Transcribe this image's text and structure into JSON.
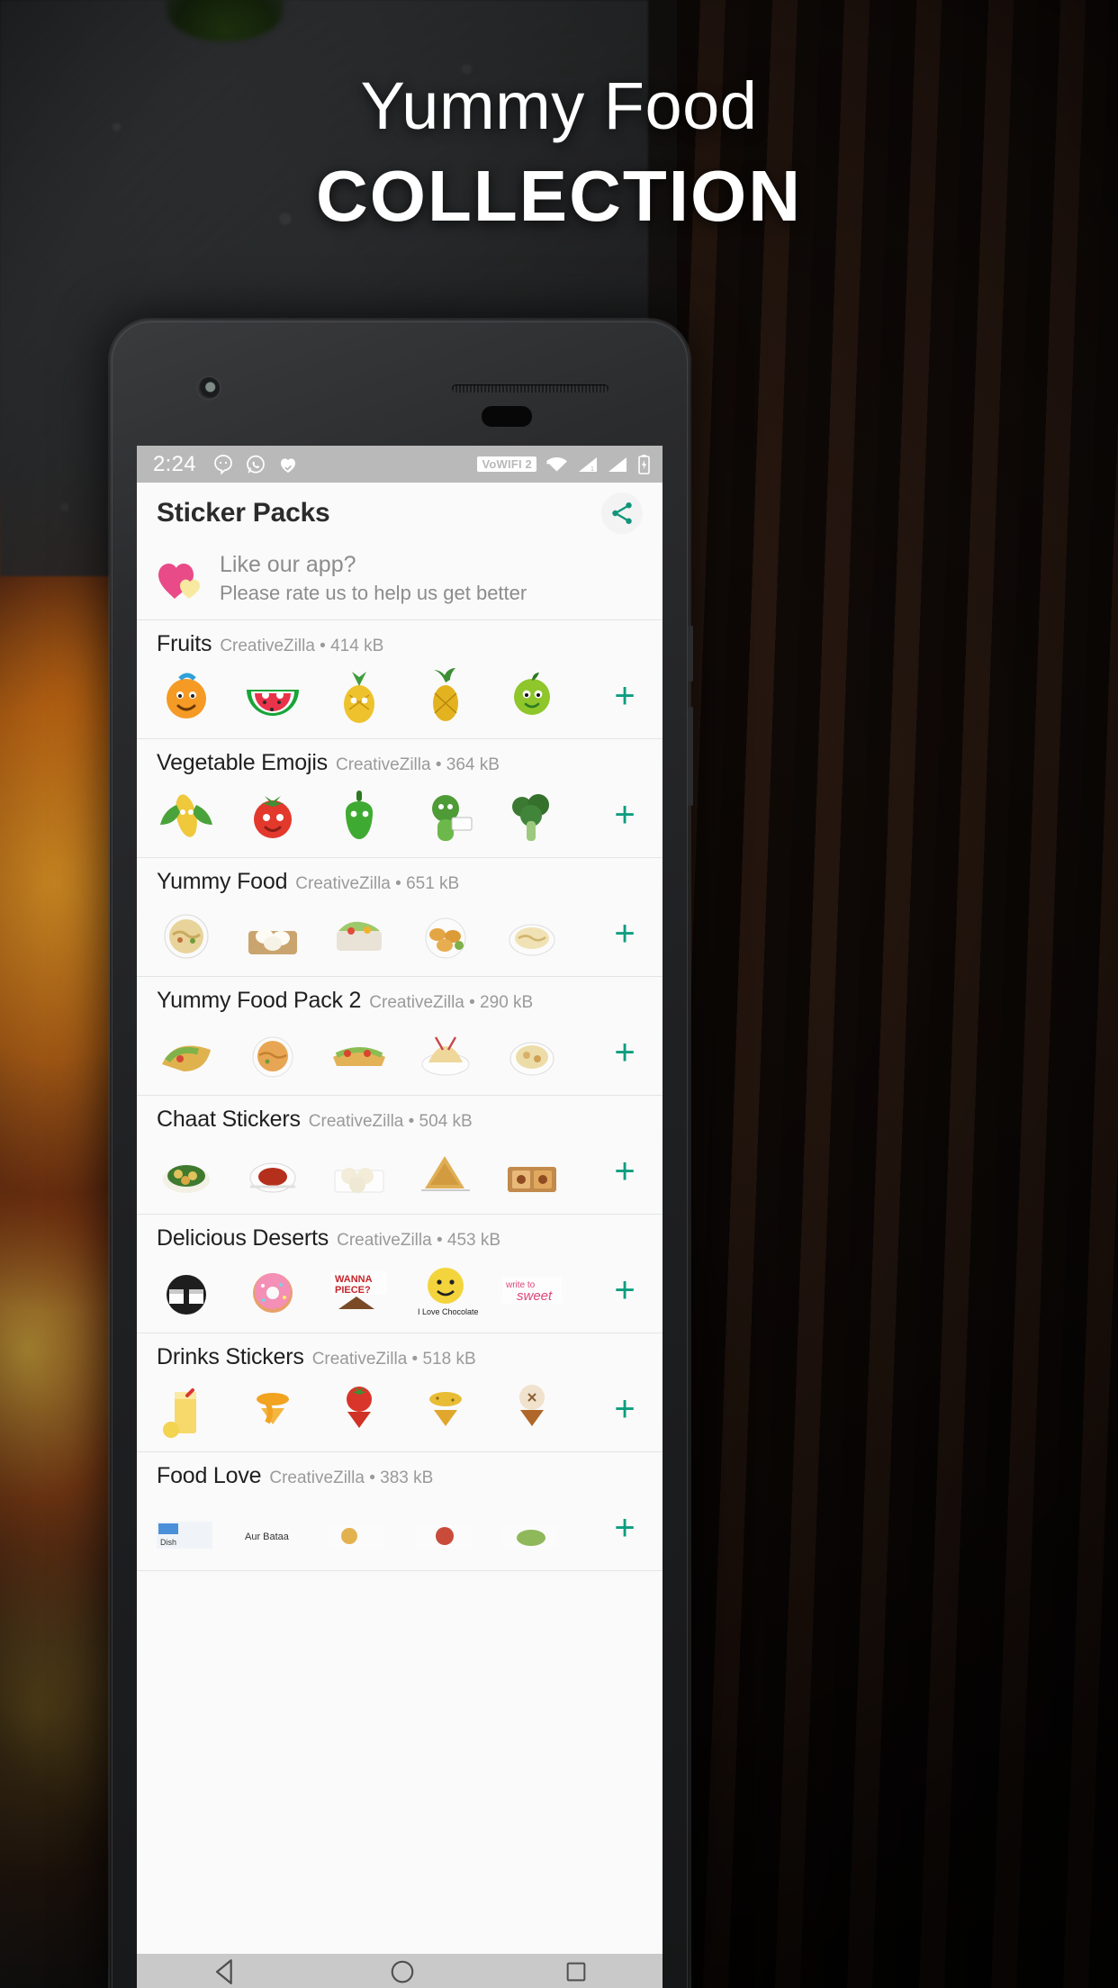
{
  "poster": {
    "headline_line1": "Yummy Food",
    "headline_line2": "COLLECTION"
  },
  "statusbar": {
    "time": "2:24",
    "notification_icons": [
      "hangouts-icon",
      "whatsapp-icon",
      "heart-check-icon"
    ],
    "network_badge": "VoWIFI 2",
    "right_icons": [
      "wifi-icon",
      "signal-1-icon",
      "signal-2-icon",
      "battery-icon"
    ],
    "bg_color": "#b9b9b9"
  },
  "appbar": {
    "title": "Sticker Packs",
    "share_icon": "share-icon",
    "accent_color": "#0d9d7e"
  },
  "rate_banner": {
    "icon": "heart-icon",
    "title": "Like our app?",
    "subtitle": "Please rate us to help us get better"
  },
  "list": {
    "author": "CreativeZilla",
    "separator": "•",
    "add_label": "+",
    "packs": [
      {
        "name": "Fruits",
        "author": "CreativeZilla",
        "size": "414 kB",
        "stickers": [
          "orange-face-sticker",
          "watermelon-sticker",
          "pineapple-character-sticker",
          "pineapple-sticker",
          "green-apple-sticker"
        ]
      },
      {
        "name": "Vegetable Emojis",
        "author": "CreativeZilla",
        "size": "364 kB",
        "stickers": [
          "corn-sticker",
          "tomato-sticker",
          "bell-pepper-sticker",
          "coconut-sticker",
          "broccoli-sticker"
        ]
      },
      {
        "name": "Yummy Food",
        "author": "CreativeZilla",
        "size": "651 kB",
        "stickers": [
          "noodle-bowl-sticker",
          "dumpling-plate-sticker",
          "salad-wrap-sticker",
          "nuggets-sticker",
          "pasta-bowl-sticker"
        ]
      },
      {
        "name": "Yummy Food Pack 2",
        "author": "CreativeZilla",
        "size": "290 kB",
        "stickers": [
          "taco-sticker",
          "fried-rice-sticker",
          "sandwich-sticker",
          "noodles-plate-sticker",
          "soup-bowl-sticker"
        ]
      },
      {
        "name": "Chaat Stickers",
        "author": "CreativeZilla",
        "size": "504 kB",
        "stickers": [
          "chaat-plate-sticker",
          "curry-bowl-sticker",
          "dahi-puri-sticker",
          "samosa-sticker",
          "sweets-box-sticker"
        ]
      },
      {
        "name": "Delicious Deserts",
        "author": "CreativeZilla",
        "size": "453 kB",
        "stickers": [
          "cake-slice-sticker",
          "pink-donut-sticker",
          "wanna-piece-sticker",
          "i-love-chocolate-sticker",
          "write-to-sweet-sticker"
        ]
      },
      {
        "name": "Drinks Stickers",
        "author": "CreativeZilla",
        "size": "518 kB",
        "stickers": [
          "lemonade-glass-sticker",
          "orange-juice-sticker",
          "tomato-juice-sticker",
          "pineapple-juice-sticker",
          "apple-juice-sticker"
        ]
      },
      {
        "name": "Food Love",
        "author": "CreativeZilla",
        "size": "383 kB",
        "stickers": [
          "food-love-sticker-1",
          "food-love-sticker-2",
          "food-love-sticker-3",
          "food-love-sticker-4",
          "food-love-sticker-5"
        ]
      }
    ]
  },
  "navbar": {
    "back_icon": "back-triangle-icon",
    "home_icon": "home-circle-icon",
    "recents_icon": "recents-square-icon"
  }
}
